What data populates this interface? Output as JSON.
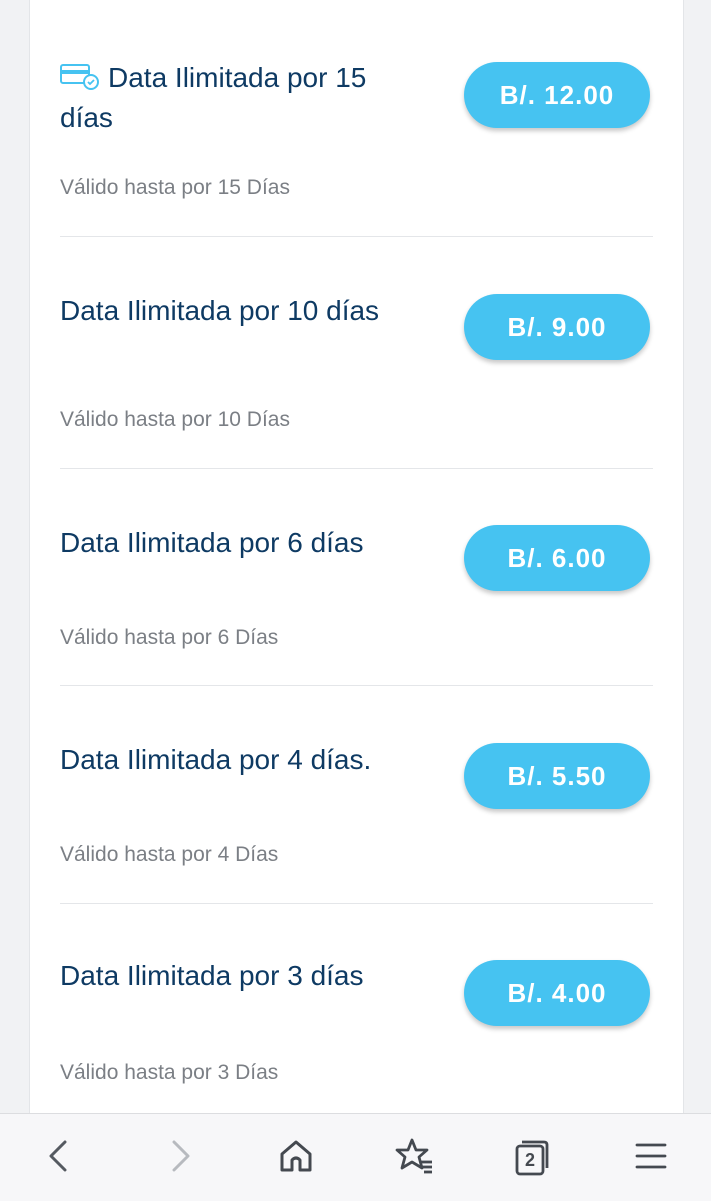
{
  "plans": [
    {
      "title": "Data Ilimitada por 15 días",
      "validity": "Válido hasta por 15 Días",
      "price": "B/. 12.00"
    },
    {
      "title": "Data Ilimitada por 10 días",
      "validity": "Válido hasta por 10 Días",
      "price": "B/. 9.00"
    },
    {
      "title": "Data Ilimitada por 6 días",
      "validity": "Válido hasta por 6 Días",
      "price": "B/. 6.00"
    },
    {
      "title": "Data Ilimitada por 4 días.",
      "validity": "Válido hasta por 4 Días",
      "price": "B/. 5.50"
    },
    {
      "title": "Data Ilimitada por 3 días",
      "validity": "Válido hasta por 3 Días",
      "price": "B/. 4.00"
    }
  ],
  "browser_nav": {
    "tab_count": "2",
    "icons": [
      "back-icon",
      "forward-icon",
      "home-icon",
      "bookmarks-icon",
      "tabs-icon",
      "menu-icon"
    ]
  },
  "colors": {
    "accent": "#46c3f1",
    "title_text": "#0e3a63",
    "secondary_text": "#7b7f85"
  }
}
